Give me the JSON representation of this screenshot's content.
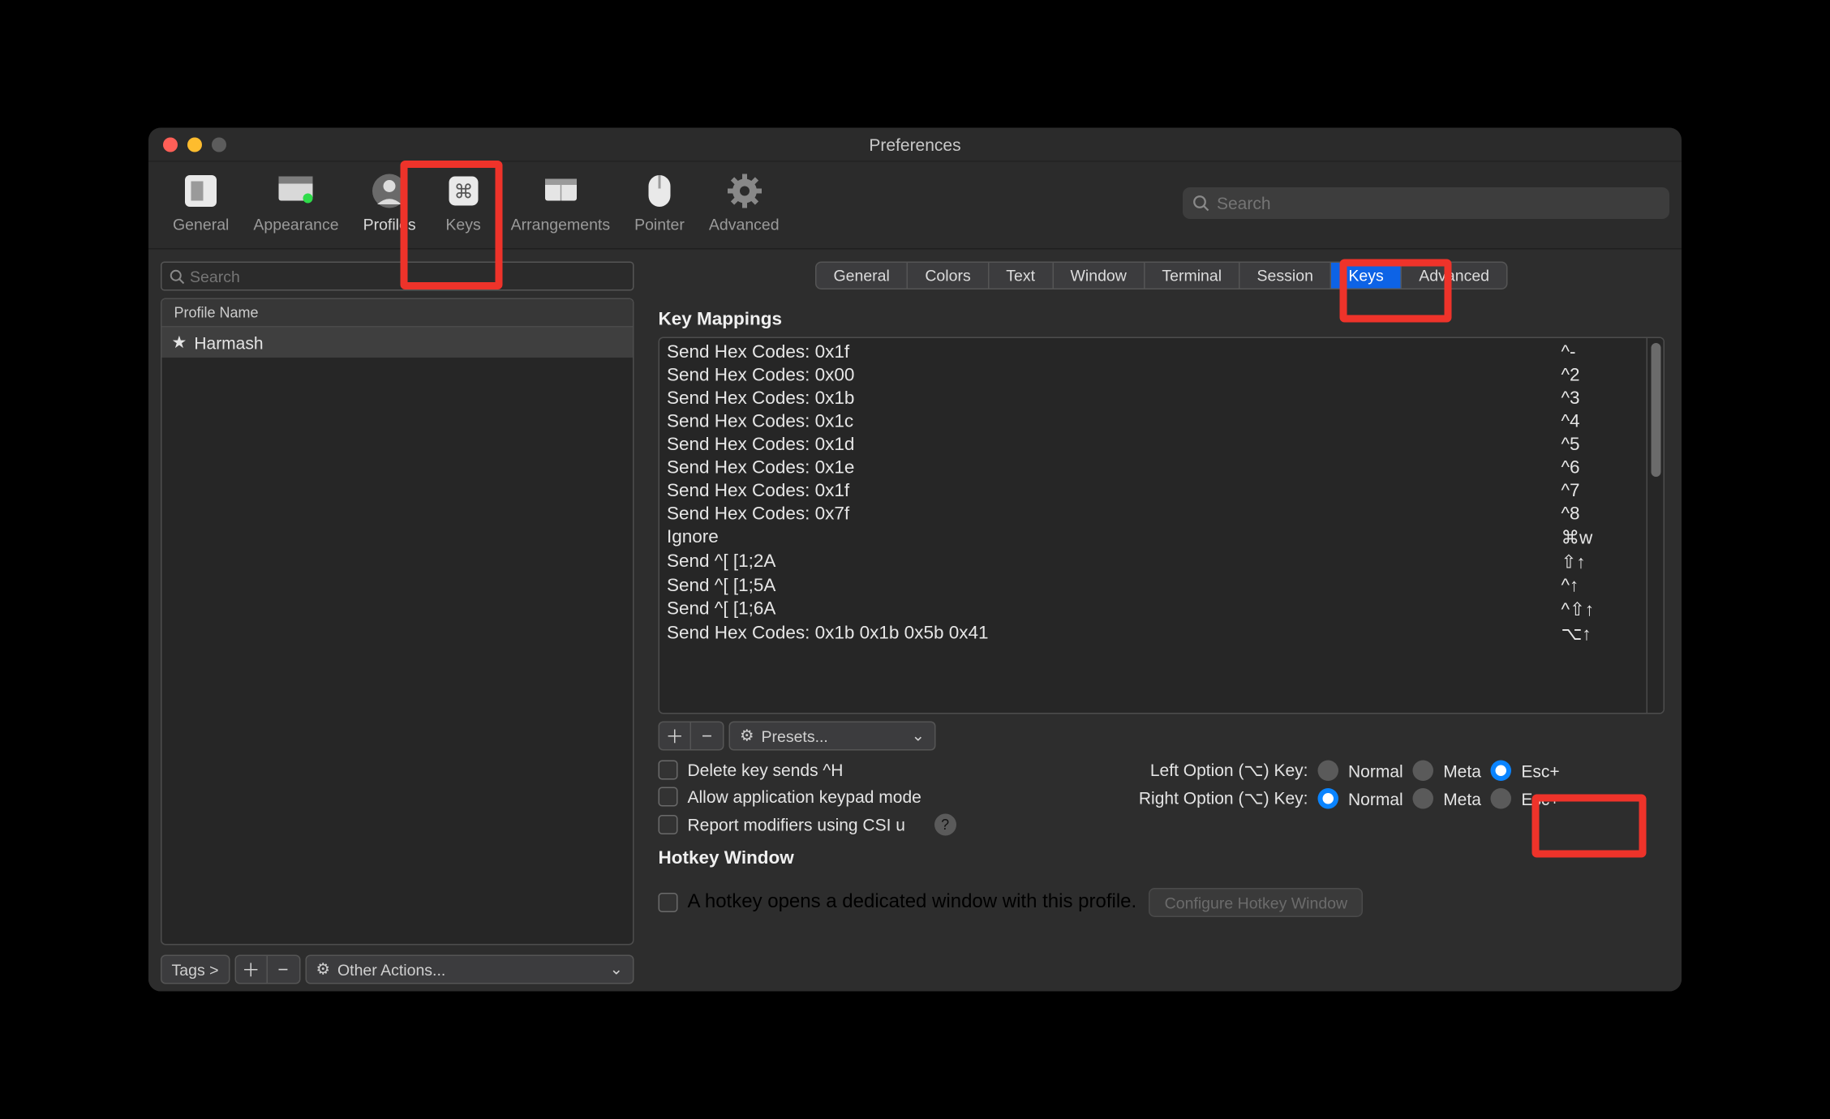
{
  "window": {
    "title": "Preferences"
  },
  "toolbar": {
    "items": [
      {
        "id": "general",
        "label": "General"
      },
      {
        "id": "appearance",
        "label": "Appearance"
      },
      {
        "id": "profiles",
        "label": "Profiles"
      },
      {
        "id": "keys",
        "label": "Keys"
      },
      {
        "id": "arrangements",
        "label": "Arrangements"
      },
      {
        "id": "pointer",
        "label": "Pointer"
      },
      {
        "id": "advanced",
        "label": "Advanced"
      }
    ],
    "selected": "profiles",
    "search_placeholder": "Search"
  },
  "sidebar": {
    "search_placeholder": "Search",
    "column_header": "Profile Name",
    "profiles": [
      {
        "name": "Harmash",
        "is_default": true
      }
    ],
    "tags_label": "Tags >",
    "other_actions_label": "Other Actions..."
  },
  "subtabs": {
    "items": [
      "General",
      "Colors",
      "Text",
      "Window",
      "Terminal",
      "Session",
      "Keys",
      "Advanced"
    ],
    "active": "Keys"
  },
  "key_mappings": {
    "heading": "Key Mappings",
    "rows": [
      {
        "action": "Send Hex Codes: 0x1f",
        "shortcut": "^-"
      },
      {
        "action": "Send Hex Codes: 0x00",
        "shortcut": "^2"
      },
      {
        "action": "Send Hex Codes: 0x1b",
        "shortcut": "^3"
      },
      {
        "action": "Send Hex Codes: 0x1c",
        "shortcut": "^4"
      },
      {
        "action": "Send Hex Codes: 0x1d",
        "shortcut": "^5"
      },
      {
        "action": "Send Hex Codes: 0x1e",
        "shortcut": "^6"
      },
      {
        "action": "Send Hex Codes: 0x1f",
        "shortcut": "^7"
      },
      {
        "action": "Send Hex Codes: 0x7f",
        "shortcut": "^8"
      },
      {
        "action": "Ignore",
        "shortcut": "⌘w"
      },
      {
        "action": "Send ^[ [1;2A",
        "shortcut": "⇧↑"
      },
      {
        "action": "Send ^[ [1;5A",
        "shortcut": "^↑"
      },
      {
        "action": "Send ^[ [1;6A",
        "shortcut": "^⇧↑"
      },
      {
        "action": "Send Hex Codes: 0x1b 0x1b 0x5b 0x41",
        "shortcut": "⌥↑"
      }
    ],
    "presets_label": "Presets..."
  },
  "options": {
    "delete_sends_hex": {
      "label": "Delete key sends ^H",
      "checked": false
    },
    "allow_keypad": {
      "label": "Allow application keypad mode",
      "checked": false
    },
    "report_csiu": {
      "label": "Report modifiers using CSI u",
      "checked": false
    },
    "left_option": {
      "label": "Left Option (⌥) Key:",
      "choices": [
        "Normal",
        "Meta",
        "Esc+"
      ],
      "value": "Esc+"
    },
    "right_option": {
      "label": "Right Option (⌥) Key:",
      "choices": [
        "Normal",
        "Meta",
        "Esc+"
      ],
      "value": "Normal"
    }
  },
  "hotkey": {
    "heading": "Hotkey Window",
    "checkbox_label": "A hotkey opens a dedicated window with this profile.",
    "configure_label": "Configure Hotkey Window"
  },
  "glyphs": {
    "star": "★",
    "plus": "＋",
    "minus": "−",
    "gear": "⚙",
    "caret_down": "⌄",
    "question": "?"
  }
}
